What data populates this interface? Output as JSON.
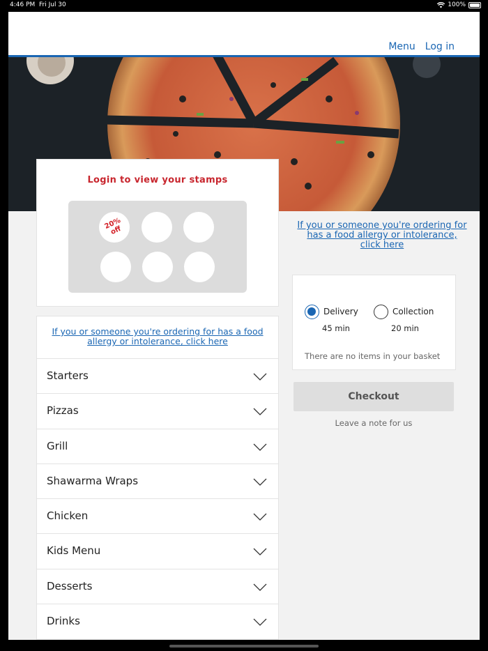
{
  "status_bar": {
    "time": "4:46 PM",
    "date": "Fri Jul 30",
    "battery": "100%"
  },
  "nav": {
    "menu": "Menu",
    "login": "Log in"
  },
  "stamps": {
    "title": "Login to view your stamps",
    "reward_line1": "20%",
    "reward_line2": "off"
  },
  "allergy_text": "If you or someone you're ordering for has a food allergy or intolerance, click here",
  "categories": [
    "Starters",
    "Pizzas",
    "Grill",
    "Shawarma Wraps",
    "Chicken",
    "Kids Menu",
    "Desserts",
    "Drinks"
  ],
  "basket": {
    "delivery_label": "Delivery",
    "delivery_time": "45 min",
    "collection_label": "Collection",
    "collection_time": "20 min",
    "selected": "Delivery",
    "empty_text": "There are no items in your basket"
  },
  "checkout_label": "Checkout",
  "note_label": "Leave a note for us",
  "colors": {
    "accent": "#1a66b3",
    "stamp_red": "#c8262e",
    "background": "#f2f2f2"
  }
}
